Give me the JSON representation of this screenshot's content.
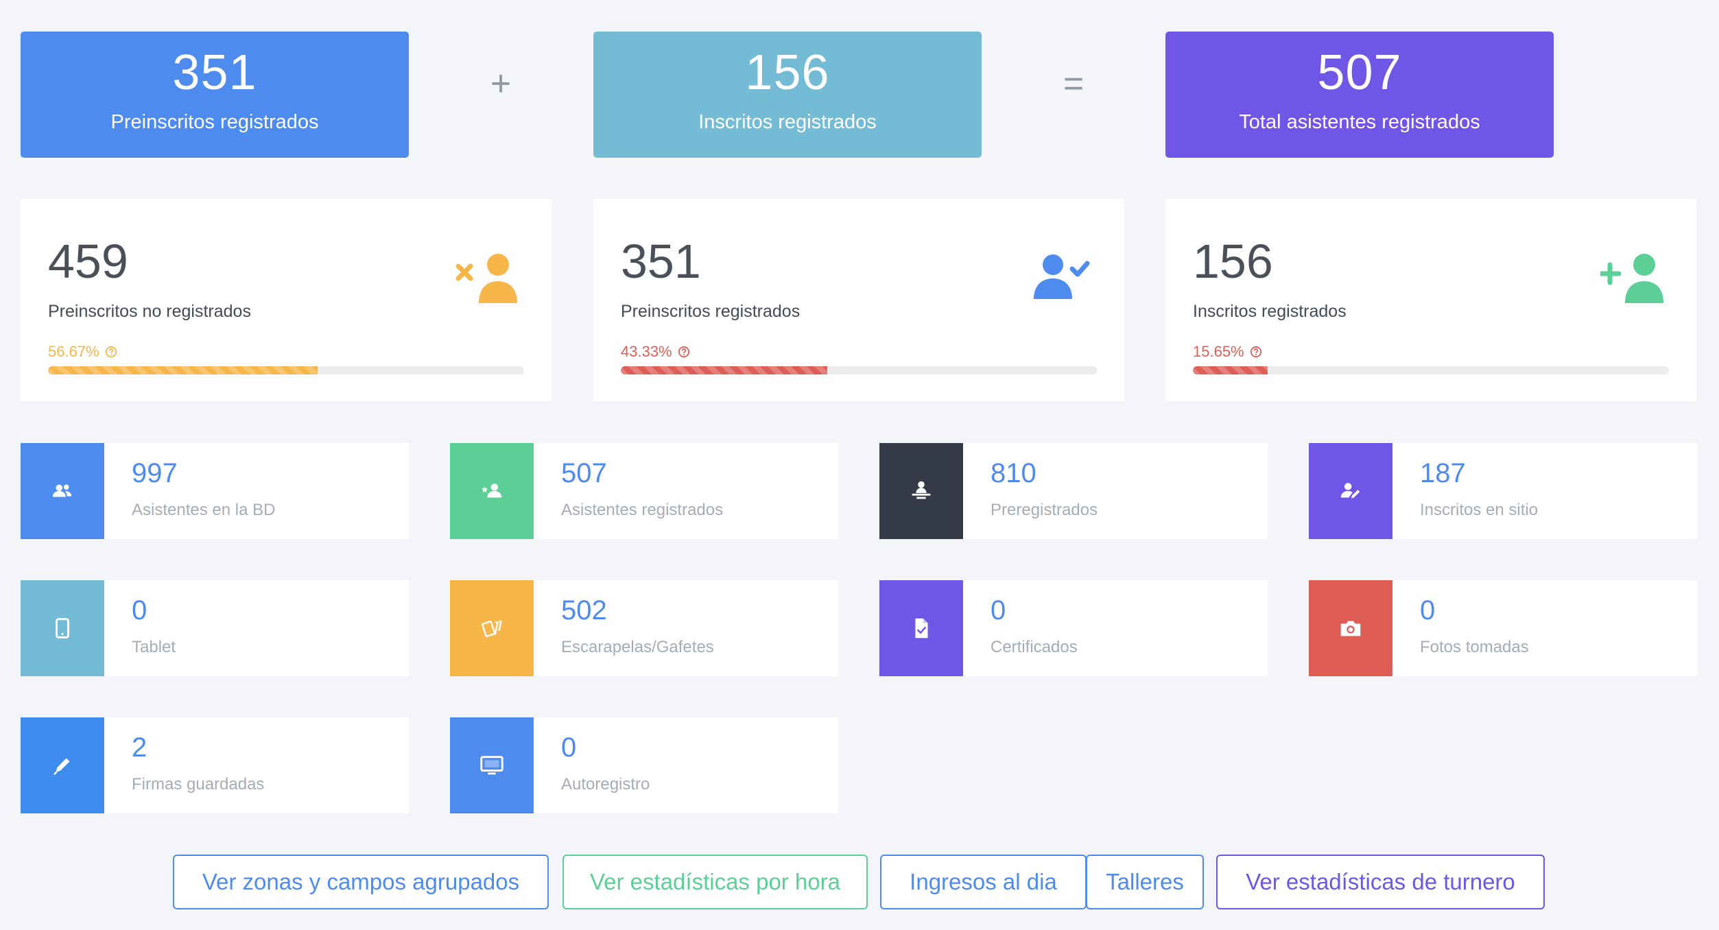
{
  "summary": [
    {
      "value": "351",
      "label": "Preinscritos registrados",
      "color": "#4e8bee"
    },
    {
      "value": "156",
      "label": "Inscritos registrados",
      "color": "#74bcd6"
    },
    {
      "value": "507",
      "label": "Total asistentes registrados",
      "color": "#6f56e6"
    }
  ],
  "operators": {
    "plus": "+",
    "equals": "="
  },
  "progress_cards": [
    {
      "value": "459",
      "label": "Preinscritos no registrados",
      "percent_text": "56.67%",
      "percent": 56.67,
      "color": "#f6b649",
      "icon": "user-times-icon"
    },
    {
      "value": "351",
      "label": "Preinscritos registrados",
      "percent_text": "43.33%",
      "percent": 43.33,
      "color": "#de5e56",
      "icon_color": "#4e8bee",
      "icon": "user-check-icon"
    },
    {
      "value": "156",
      "label": "Inscritos registrados",
      "percent_text": "15.65%",
      "percent": 15.65,
      "color": "#de5e56",
      "icon_color": "#5ccf96",
      "icon": "user-plus-icon"
    }
  ],
  "tiles": [
    {
      "value": "997",
      "label": "Asistentes en la BD",
      "color": "#4e8bee",
      "icon": "users-icon"
    },
    {
      "value": "507",
      "label": "Asistentes registrados",
      "color": "#5ccf96",
      "icon": "user-star-icon"
    },
    {
      "value": "810",
      "label": "Preregistrados",
      "color": "#343b47",
      "icon": "user-desk-icon"
    },
    {
      "value": "187",
      "label": "Inscritos en sitio",
      "color": "#6f56e6",
      "icon": "user-edit-icon"
    },
    {
      "value": "0",
      "label": "Tablet",
      "color": "#74bcd6",
      "icon": "tablet-icon"
    },
    {
      "value": "502",
      "label": "Escarapelas/Gafetes",
      "color": "#f6b649",
      "icon": "badge-cards-icon"
    },
    {
      "value": "0",
      "label": "Certificados",
      "color": "#6f56e6",
      "icon": "file-check-icon"
    },
    {
      "value": "0",
      "label": "Fotos tomadas",
      "color": "#de5e56",
      "icon": "camera-icon"
    },
    {
      "value": "2",
      "label": "Firmas guardadas",
      "color": "#3f8cf0",
      "icon": "pen-icon"
    },
    {
      "value": "0",
      "label": "Autoregistro",
      "color": "#4e8bee",
      "icon": "monitor-icon"
    }
  ],
  "buttons": [
    {
      "label": "Ver zonas y campos agrupados",
      "color": "#4e8bee"
    },
    {
      "label": "Ver estadísticas por hora",
      "color": "#5ccf96"
    },
    {
      "label": "Ingresos al dia",
      "color": "#4e8bee"
    },
    {
      "label": "Talleres",
      "color": "#4e8bee"
    },
    {
      "label": "Ver estadísticas de turnero",
      "color": "#6f56e6"
    }
  ]
}
